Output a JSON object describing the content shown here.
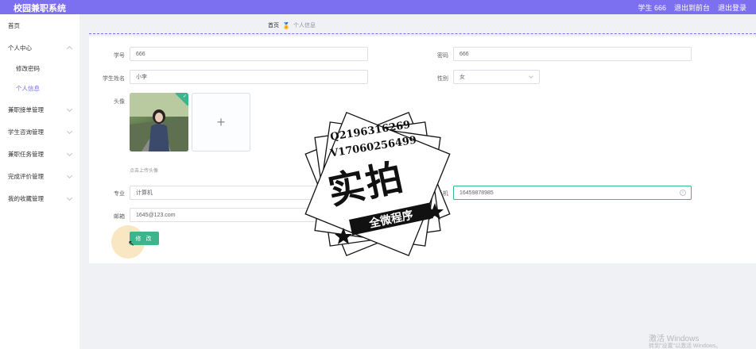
{
  "header": {
    "app_title": "校园兼职系统",
    "user_label": "学生 666",
    "to_admin": "退出到前台",
    "logout": "退出登录",
    "bg_color": "#7c6ff0"
  },
  "sidebar": {
    "items": [
      {
        "label": "首页",
        "expanded": null
      },
      {
        "label": "个人中心",
        "expanded": true
      },
      {
        "label": "修改密码",
        "sub": true
      },
      {
        "label": "个人信息",
        "sub": true,
        "active": true
      },
      {
        "label": "兼职接单管理",
        "expanded": false
      },
      {
        "label": "学生咨询管理",
        "expanded": false
      },
      {
        "label": "兼职任务管理",
        "expanded": false
      },
      {
        "label": "完成评价管理",
        "expanded": false
      },
      {
        "label": "我的收藏管理",
        "expanded": false
      }
    ]
  },
  "breadcrumb": {
    "home": "首页",
    "separator_icon": "medal-icon",
    "current": "个人信息"
  },
  "form": {
    "student_no_label": "学号",
    "student_no_value": "666",
    "password_label": "密码",
    "password_value": "666",
    "name_label": "学生姓名",
    "name_value": "小李",
    "gender_label": "性别",
    "gender_value": "女",
    "avatar_label": "头像",
    "upload_hint": "点击上传头像",
    "major_label": "专业",
    "major_value": "计算机",
    "phone_label": "手机",
    "phone_value": "16459878985",
    "email_label": "邮箱",
    "email_value": "1645@123.com",
    "submit_label": "修 改"
  },
  "watermark": {
    "line1": "Q2196316269",
    "line2": "V17060256499",
    "big": "实拍",
    "ribbon": "全微程序"
  },
  "windows_activation": {
    "title": "激活 Windows",
    "subtitle": "转到\"设置\"以激活 Windows。"
  },
  "colors": {
    "accent": "#7c6ff0",
    "button": "#3cb48c"
  }
}
